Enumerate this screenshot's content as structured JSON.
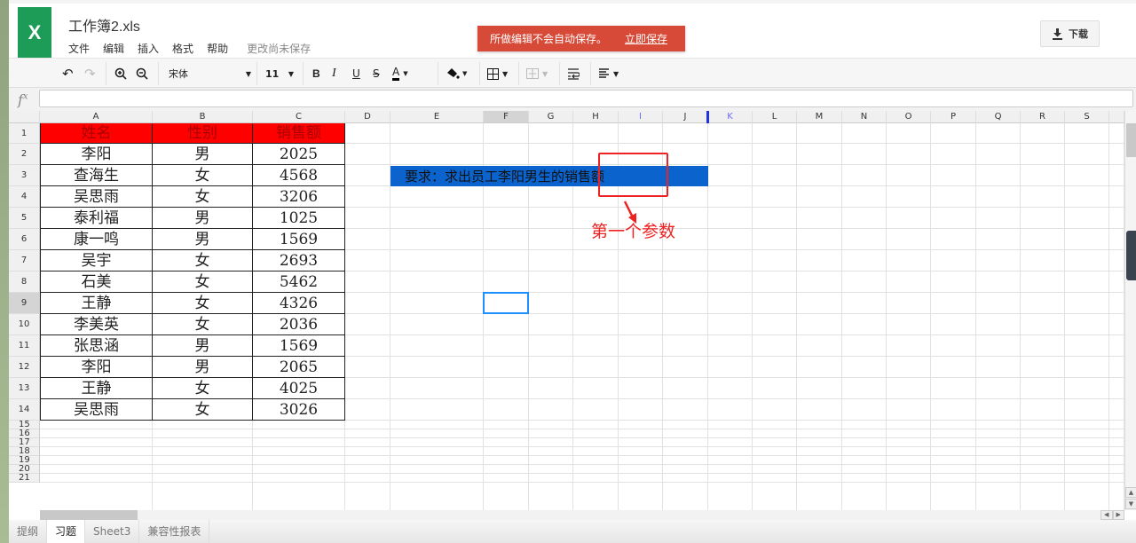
{
  "app": {
    "logo": "X",
    "title": "工作簿2.xls",
    "status": "更改尚未保存"
  },
  "menu": [
    "文件",
    "编辑",
    "插入",
    "格式",
    "帮助"
  ],
  "banner": {
    "message": "所做编辑不会自动保存。",
    "action": "立即保存",
    "color": "#d84a38"
  },
  "download": {
    "icon": "download-icon",
    "label": "下载"
  },
  "toolbar": {
    "undo": "↶",
    "redo": "↷",
    "zoom_in": "zoom-in-icon",
    "zoom_out": "zoom-out-icon",
    "font": "宋体",
    "font_size": "11",
    "bold": "B",
    "italic": "I",
    "underline": "U",
    "strike": "S",
    "font_color": "A",
    "fill_color": "fill-icon",
    "borders": "borders-icon",
    "merge": "merge-icon",
    "wrap": "wrap-icon",
    "align": "align-icon"
  },
  "formula_bar": {
    "label": "f",
    "sup": "x",
    "value": ""
  },
  "columns": [
    "A",
    "B",
    "C",
    "D",
    "E",
    "F",
    "G",
    "H",
    "I",
    "J",
    "K",
    "L",
    "M",
    "N",
    "O",
    "P",
    "Q",
    "R",
    "S"
  ],
  "rows": [
    "1",
    "2",
    "3",
    "4",
    "5",
    "6",
    "7",
    "8",
    "9",
    "10",
    "11",
    "12",
    "13",
    "14",
    "15",
    "16",
    "17",
    "18",
    "19",
    "20",
    "21"
  ],
  "table": {
    "headers": [
      "姓名",
      "性别",
      "销售额"
    ],
    "rows": [
      [
        "李阳",
        "男",
        "2025"
      ],
      [
        "查海生",
        "女",
        "4568"
      ],
      [
        "吴思雨",
        "女",
        "3206"
      ],
      [
        "泰利福",
        "男",
        "1025"
      ],
      [
        "康一鸣",
        "男",
        "1569"
      ],
      [
        "吴宇",
        "女",
        "2693"
      ],
      [
        "石美",
        "女",
        "5462"
      ],
      [
        "王静",
        "女",
        "4326"
      ],
      [
        "李美英",
        "女",
        "2036"
      ],
      [
        "张思涵",
        "男",
        "1569"
      ],
      [
        "李阳",
        "男",
        "2065"
      ],
      [
        "王静",
        "女",
        "4025"
      ],
      [
        "吴思雨",
        "女",
        "3026"
      ]
    ],
    "header_bg": "#ff0000"
  },
  "requirement": {
    "text": "要求：求出员工李阳男生的销售额",
    "bg": "#0b63ce"
  },
  "annotation": {
    "text": "第一个参数",
    "color": "#ee2222"
  },
  "selected_cell": "F9",
  "sheet_tabs": [
    {
      "label": "提纲",
      "active": false
    },
    {
      "label": "习题",
      "active": true
    },
    {
      "label": "Sheet3",
      "active": false
    },
    {
      "label": "兼容性报表",
      "active": false
    }
  ]
}
